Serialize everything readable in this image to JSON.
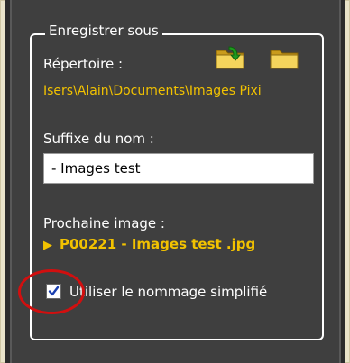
{
  "panel": {
    "group_title": "Enregistrer sous",
    "directory_label": "Répertoire :",
    "directory_path": "Isers\\Alain\\Documents\\Images Pixi",
    "name_suffix_label": "Suffixe du nom :",
    "name_suffix_value": "- Images test",
    "next_image_label": "Prochaine image :",
    "next_image_name": "P00221 - Images test .jpg",
    "simplified_naming_label": "Utiliser le nommage simplifié",
    "simplified_naming_checked": true
  },
  "icons": {
    "folder_open_arrow": "folder-open-arrow-icon",
    "folder": "folder-icon",
    "next_arrow": "play-arrow-icon",
    "checkmark": "checkmark-icon"
  },
  "colors": {
    "panel_bg": "#3f3f3f",
    "accent_yellow": "#f2c200",
    "highlight_red": "#d10f0f"
  }
}
